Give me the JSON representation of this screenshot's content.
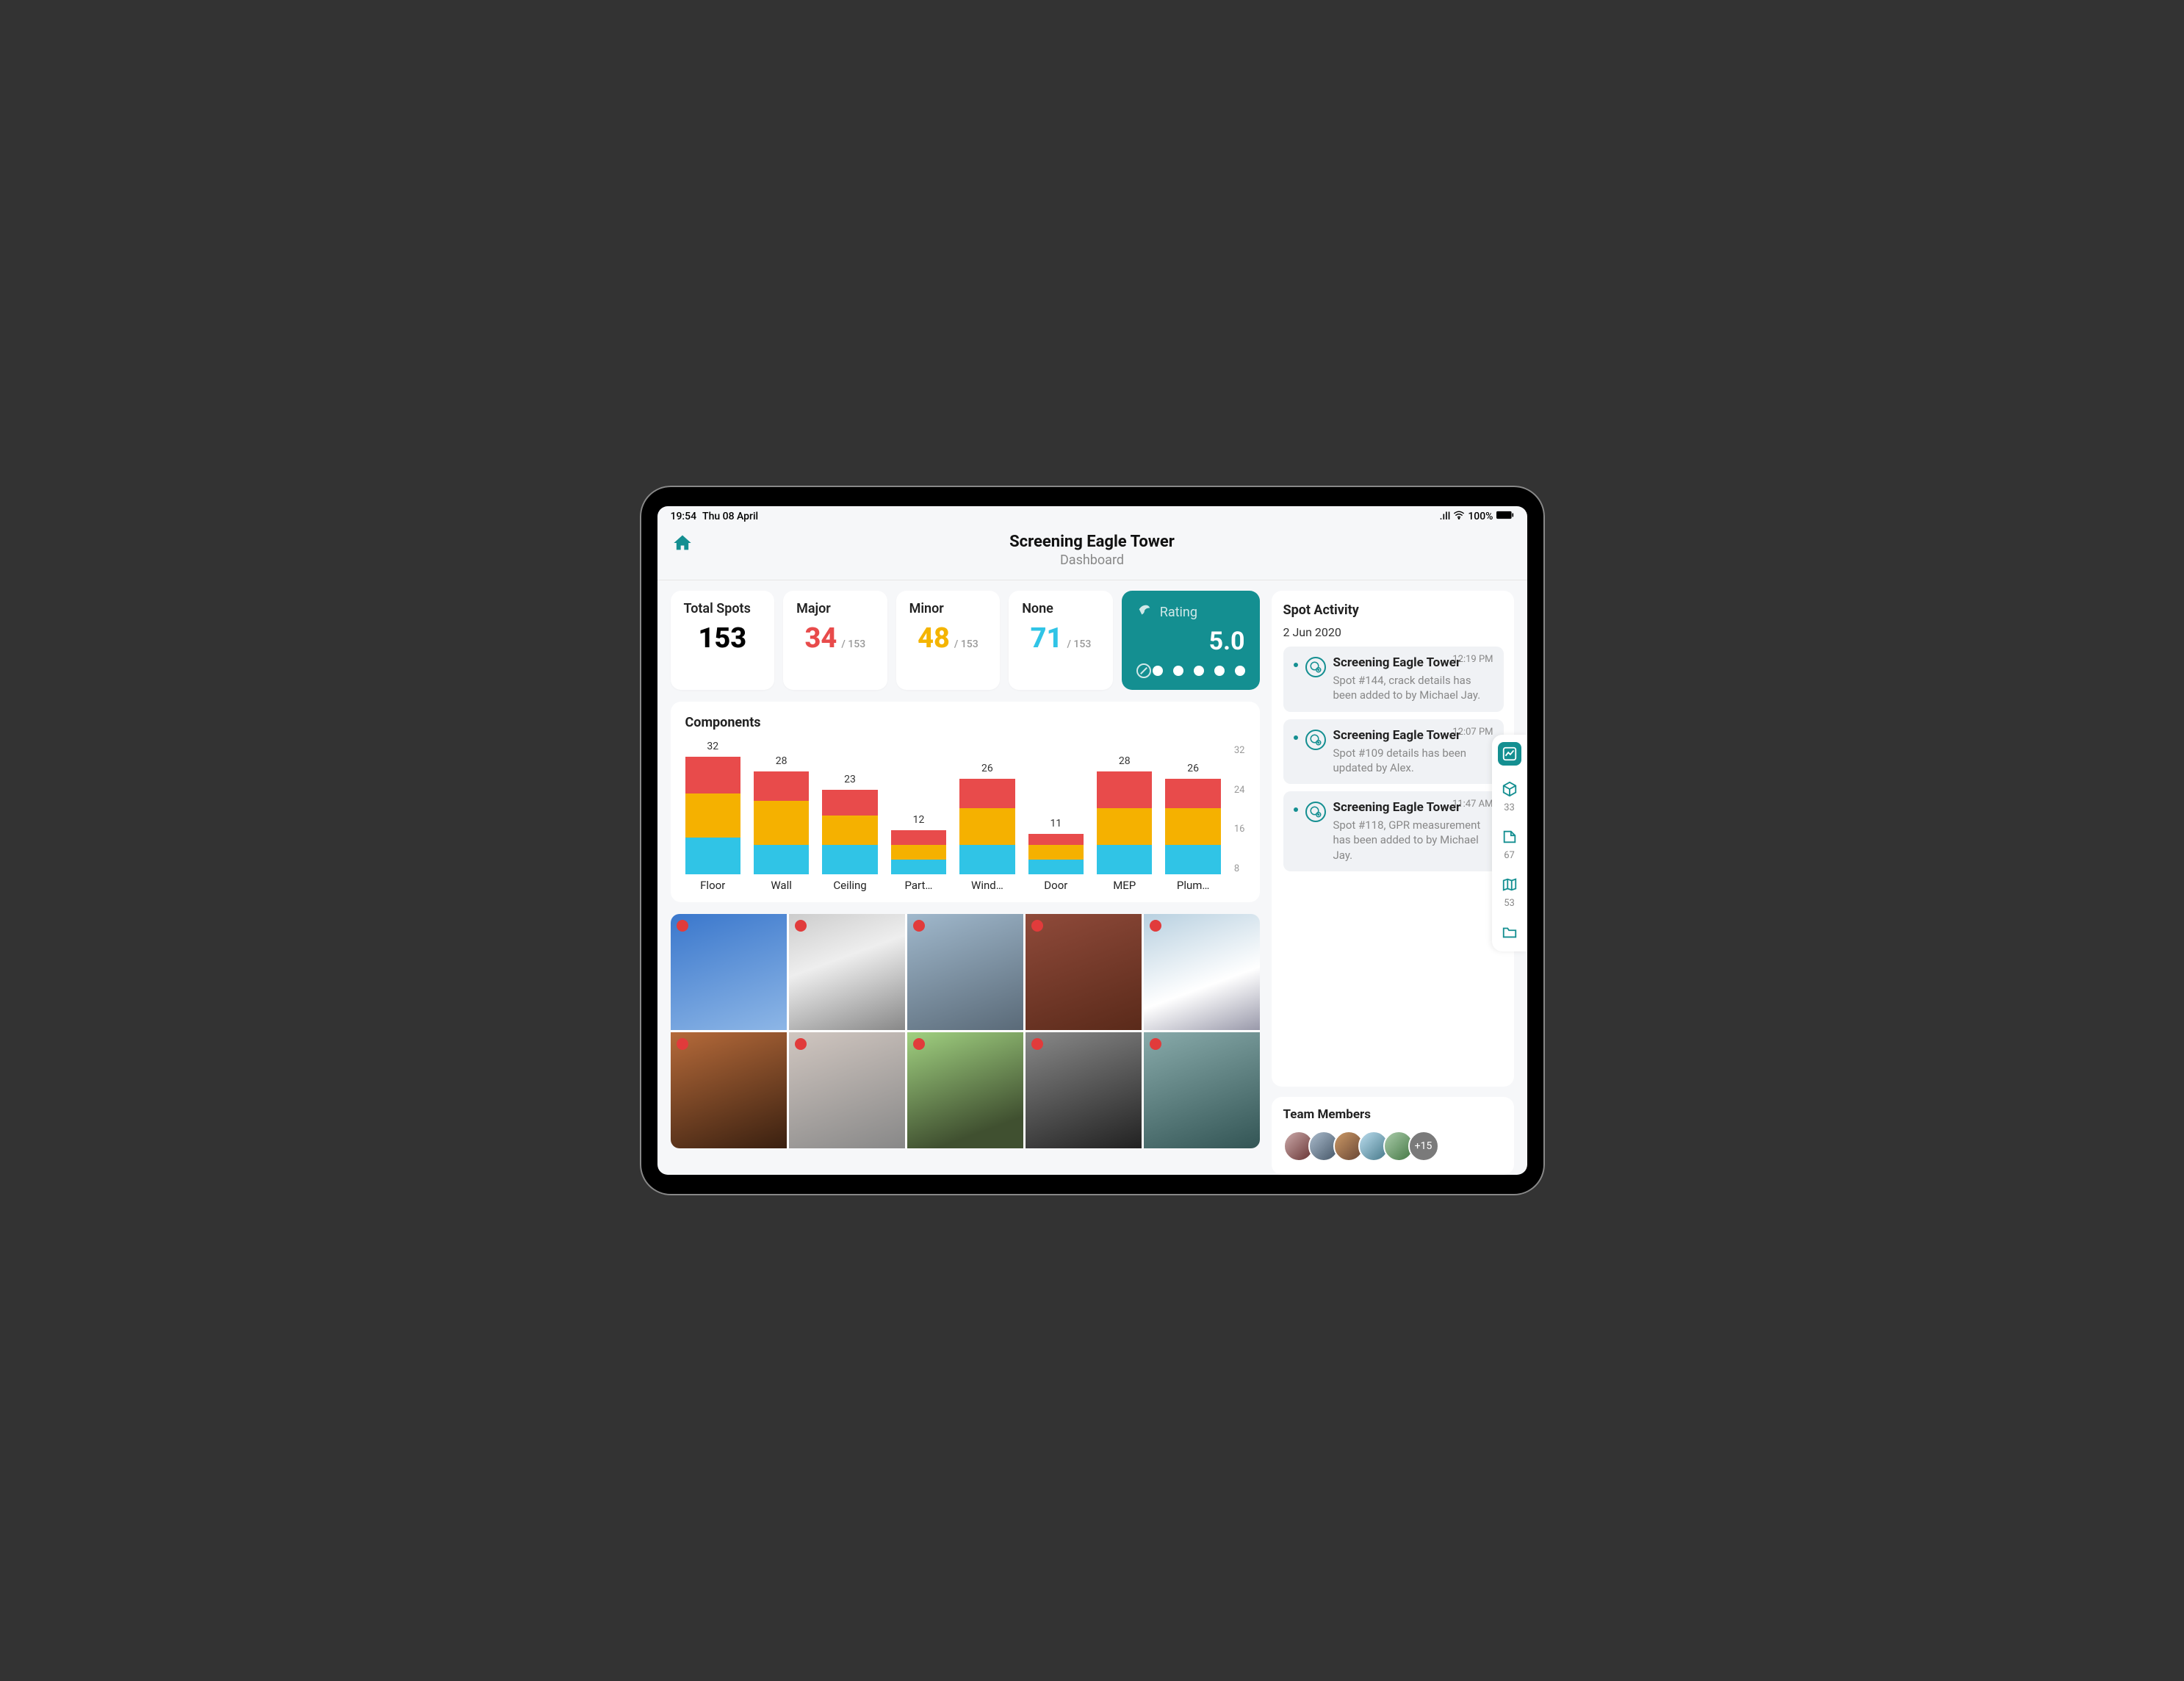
{
  "status": {
    "time": "19:54",
    "date": "Thu 08 April",
    "battery": "100%"
  },
  "header": {
    "title": "Screening Eagle Tower",
    "subtitle": "Dashboard"
  },
  "stats": {
    "total": {
      "label": "Total Spots",
      "value": "153"
    },
    "major": {
      "label": "Major",
      "value": "34",
      "suffix": "/ 153",
      "color": "#e84b4b"
    },
    "minor": {
      "label": "Minor",
      "value": "48",
      "suffix": "/ 153",
      "color": "#f4b400"
    },
    "none": {
      "label": "None",
      "value": "71",
      "suffix": "/ 153",
      "color": "#30c4e6"
    }
  },
  "rating": {
    "label": "Rating",
    "value": "5.0",
    "dots": 5
  },
  "components": {
    "title": "Components",
    "axis": [
      "32",
      "24",
      "16",
      "8"
    ]
  },
  "chart_data": {
    "type": "bar",
    "stacked": true,
    "ylim": [
      0,
      32
    ],
    "ylabel": "",
    "xlabel": "",
    "categories": [
      "Floor",
      "Wall",
      "Ceiling",
      "Part…",
      "Wind…",
      "Door",
      "MEP",
      "Plum…"
    ],
    "totals": [
      32,
      28,
      23,
      12,
      26,
      11,
      28,
      26
    ],
    "series": [
      {
        "name": "Major",
        "color": "#e84b4b",
        "values": [
          10,
          8,
          7,
          4,
          8,
          3,
          10,
          8
        ]
      },
      {
        "name": "Minor",
        "color": "#f5b100",
        "values": [
          12,
          12,
          8,
          4,
          10,
          4,
          10,
          10
        ]
      },
      {
        "name": "None",
        "color": "#30c4e6",
        "values": [
          10,
          8,
          8,
          4,
          8,
          4,
          8,
          8
        ]
      }
    ]
  },
  "activity": {
    "title": "Spot Activity",
    "date": "2 Jun 2020",
    "items": [
      {
        "title": "Screening Eagle Tower",
        "desc": "Spot #144, crack details has been added to by Michael Jay.",
        "time": "12:19 PM"
      },
      {
        "title": "Screening Eagle Tower",
        "desc": "Spot #109 details has been updated by Alex.",
        "time": "12:07 PM"
      },
      {
        "title": "Screening Eagle Tower",
        "desc": "Spot #118, GPR measurement has been added to by Michael Jay.",
        "time": "11:47 AM"
      }
    ]
  },
  "team": {
    "title": "Team Members",
    "more": "+15",
    "count": 5
  },
  "dock": [
    {
      "name": "dashboard",
      "label": ""
    },
    {
      "name": "box",
      "label": "33"
    },
    {
      "name": "plans",
      "label": "67"
    },
    {
      "name": "map",
      "label": "53"
    },
    {
      "name": "files",
      "label": ""
    }
  ]
}
